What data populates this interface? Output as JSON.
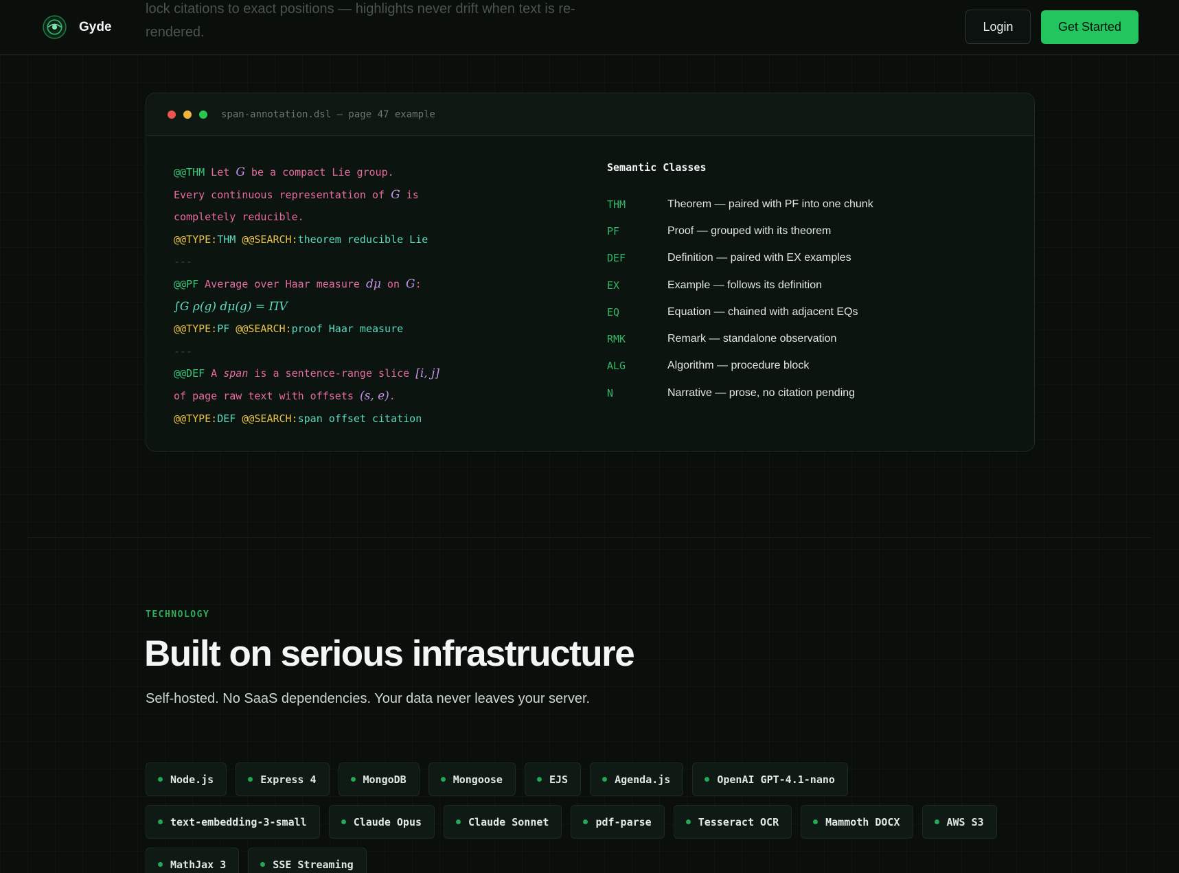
{
  "header": {
    "faded_text": "lock citations to exact positions — highlights never drift when text is re-rendered.",
    "brand": "Gyde",
    "login_label": "Login",
    "cta_label": "Get Started"
  },
  "code_panel": {
    "title": "span-annotation.dsl — page 47 example",
    "lines": {
      "l1_tag": "@@THM",
      "l1_a": " Let ",
      "l1_math": "G",
      "l1_b": " be a compact Lie group.",
      "l2_a": "Every continuous representation of ",
      "l2_math": "G",
      "l2_b": " is",
      "l3": "completely reducible.",
      "l4_type": "@@TYPE:",
      "l4_type_val": "THM",
      "l4_search": " @@SEARCH:",
      "l4_search_val": "theorem reducible Lie",
      "sep1": "---",
      "l6_tag": "@@PF",
      "l6_a": " Average over Haar measure ",
      "l6_math": "dμ",
      "l6_b": " on ",
      "l6_math2": "G",
      "l6_c": ":",
      "l7_math": "∫G ρ(g) dμ(g) = ΠV",
      "l8_type": "@@TYPE:",
      "l8_type_val": "PF",
      "l8_search": " @@SEARCH:",
      "l8_search_val": "proof Haar measure",
      "sep2": "---",
      "l10_tag": "@@DEF",
      "l10_a": " A ",
      "l10_em": "span",
      "l10_b": " is a sentence-range slice ",
      "l10_math": "[i, j]",
      "l11_a": "of page raw text with offsets ",
      "l11_math": "(s, e)",
      "l11_b": ".",
      "l12_type": "@@TYPE:",
      "l12_type_val": "DEF",
      "l12_search": " @@SEARCH:",
      "l12_search_val": "span offset citation"
    },
    "semantic_title": "Semantic Classes",
    "semantic_classes": [
      {
        "code": "THM",
        "desc": "Theorem — paired with PF into one chunk"
      },
      {
        "code": "PF",
        "desc": "Proof — grouped with its theorem"
      },
      {
        "code": "DEF",
        "desc": "Definition — paired with EX examples"
      },
      {
        "code": "EX",
        "desc": "Example — follows its definition"
      },
      {
        "code": "EQ",
        "desc": "Equation — chained with adjacent EQs"
      },
      {
        "code": "RMK",
        "desc": "Remark — standalone observation"
      },
      {
        "code": "ALG",
        "desc": "Algorithm — procedure block"
      },
      {
        "code": "N",
        "desc": "Narrative — prose, no citation pending"
      }
    ]
  },
  "technology": {
    "eyebrow": "TECHNOLOGY",
    "headline": "Built on serious infrastructure",
    "subhead": "Self-hosted. No SaaS dependencies. Your data never leaves your server.",
    "chips_row1": [
      "Node.js",
      "Express 4",
      "MongoDB",
      "Mongoose",
      "EJS",
      "Agenda.js",
      "OpenAI GPT-4.1-nano"
    ],
    "chips_row2": [
      "text-embedding-3-small",
      "Claude Opus",
      "Claude Sonnet",
      "pdf-parse",
      "Tesseract OCR",
      "Mammoth DOCX",
      "AWS S3"
    ],
    "chips_row3": [
      "MathJax 3",
      "SSE Streaming"
    ]
  },
  "colors": {
    "accent": "#22c55e",
    "background": "#0a0f0c",
    "pink": "#e86aa0",
    "yellow": "#e8c14a",
    "teal": "#5fdac0"
  },
  "icons": {
    "logo": "gyde-logo-icon",
    "window_dots": [
      "red-dot-icon",
      "yellow-dot-icon",
      "green-dot-icon"
    ],
    "chip_bullet": "bullet-dot-icon"
  }
}
